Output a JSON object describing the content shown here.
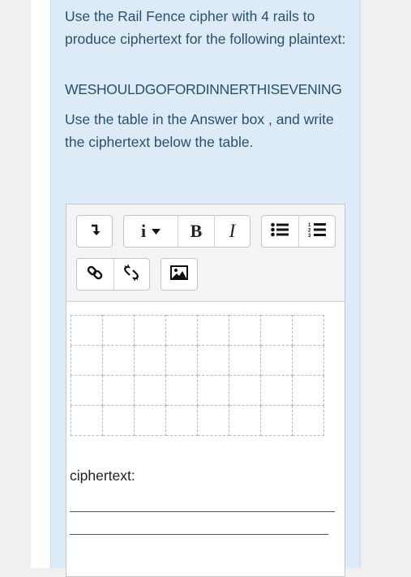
{
  "question": {
    "instruction": "Use the Rail Fence cipher with 4 rails to produce ciphertext for the following plaintext:",
    "plaintext": "WESHOULDGOFORDINNERTHISEVENING",
    "answer_instruction": "Use the table in the Answer box , and write the ciphertext below the table."
  },
  "toolbar": {
    "buttons": [
      {
        "name": "paragraph-format",
        "icon": "arrow-down-right-icon"
      },
      {
        "name": "more-formatting",
        "label": "i",
        "icon": "chevron-down-icon"
      },
      {
        "name": "bold",
        "label": "B"
      },
      {
        "name": "italic",
        "label": "I"
      },
      {
        "name": "bulleted-list",
        "icon": "bulleted-list-icon"
      },
      {
        "name": "numbered-list",
        "icon": "numbered-list-icon"
      },
      {
        "name": "link",
        "icon": "link-icon"
      },
      {
        "name": "unlink",
        "icon": "unlink-icon"
      },
      {
        "name": "image",
        "icon": "image-icon"
      }
    ]
  },
  "answer_box": {
    "table_rows": 4,
    "table_cols": 8,
    "ciphertext_label": "ciphertext:"
  },
  "colors": {
    "panel_bg": "#dcebf7",
    "question_text": "#29516d"
  }
}
